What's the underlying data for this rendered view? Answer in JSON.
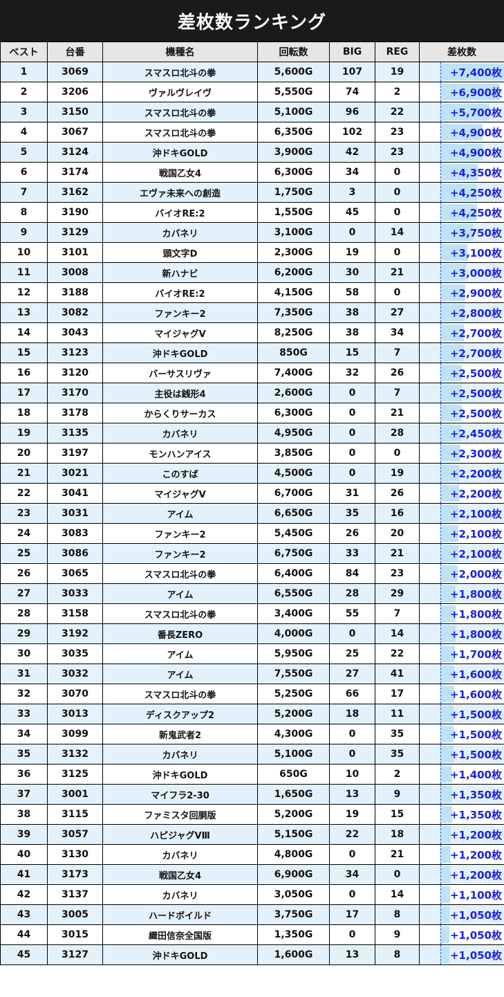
{
  "title": "差枚数ランキング",
  "colors": {
    "header_bg": "#1a1a1a",
    "row_alt": "#e3f1fc",
    "diff_text": "#1a22e0",
    "bar": "#bfe2f6"
  },
  "columns": [
    "ベスト",
    "台番",
    "機種名",
    "回転数",
    "BIG",
    "REG",
    "差枚数"
  ],
  "rows": [
    {
      "rank": "1",
      "machine": "3069",
      "model": "スマスロ北斗の拳",
      "spins": "5,600G",
      "big": "107",
      "reg": "19",
      "diff": "+7,400枚",
      "diff_value": 7400
    },
    {
      "rank": "2",
      "machine": "3206",
      "model": "ヴァルヴレイヴ",
      "spins": "5,550G",
      "big": "74",
      "reg": "2",
      "diff": "+6,900枚",
      "diff_value": 6900
    },
    {
      "rank": "3",
      "machine": "3150",
      "model": "スマスロ北斗の拳",
      "spins": "5,100G",
      "big": "96",
      "reg": "22",
      "diff": "+5,700枚",
      "diff_value": 5700
    },
    {
      "rank": "4",
      "machine": "3067",
      "model": "スマスロ北斗の拳",
      "spins": "6,350G",
      "big": "102",
      "reg": "23",
      "diff": "+4,900枚",
      "diff_value": 4900
    },
    {
      "rank": "5",
      "machine": "3124",
      "model": "沖ドキGOLD",
      "spins": "3,900G",
      "big": "42",
      "reg": "23",
      "diff": "+4,900枚",
      "diff_value": 4900
    },
    {
      "rank": "6",
      "machine": "3174",
      "model": "戦国乙女4",
      "spins": "6,300G",
      "big": "34",
      "reg": "0",
      "diff": "+4,350枚",
      "diff_value": 4350
    },
    {
      "rank": "7",
      "machine": "3162",
      "model": "エヴァ未来への創造",
      "spins": "1,750G",
      "big": "3",
      "reg": "0",
      "diff": "+4,250枚",
      "diff_value": 4250
    },
    {
      "rank": "8",
      "machine": "3190",
      "model": "バイオRE:2",
      "spins": "1,550G",
      "big": "45",
      "reg": "0",
      "diff": "+4,250枚",
      "diff_value": 4250
    },
    {
      "rank": "9",
      "machine": "3129",
      "model": "カバネリ",
      "spins": "3,100G",
      "big": "0",
      "reg": "14",
      "diff": "+3,750枚",
      "diff_value": 3750
    },
    {
      "rank": "10",
      "machine": "3101",
      "model": "頭文字D",
      "spins": "2,300G",
      "big": "19",
      "reg": "0",
      "diff": "+3,100枚",
      "diff_value": 3100
    },
    {
      "rank": "11",
      "machine": "3008",
      "model": "新ハナビ",
      "spins": "6,200G",
      "big": "30",
      "reg": "21",
      "diff": "+3,000枚",
      "diff_value": 3000
    },
    {
      "rank": "12",
      "machine": "3188",
      "model": "バイオRE:2",
      "spins": "4,150G",
      "big": "58",
      "reg": "0",
      "diff": "+2,900枚",
      "diff_value": 2900
    },
    {
      "rank": "13",
      "machine": "3082",
      "model": "ファンキー2",
      "spins": "7,350G",
      "big": "38",
      "reg": "27",
      "diff": "+2,800枚",
      "diff_value": 2800
    },
    {
      "rank": "14",
      "machine": "3043",
      "model": "マイジャグV",
      "spins": "8,250G",
      "big": "38",
      "reg": "34",
      "diff": "+2,700枚",
      "diff_value": 2700
    },
    {
      "rank": "15",
      "machine": "3123",
      "model": "沖ドキGOLD",
      "spins": "850G",
      "big": "15",
      "reg": "7",
      "diff": "+2,700枚",
      "diff_value": 2700
    },
    {
      "rank": "16",
      "machine": "3120",
      "model": "バーサスリヴァ",
      "spins": "7,400G",
      "big": "32",
      "reg": "26",
      "diff": "+2,500枚",
      "diff_value": 2500
    },
    {
      "rank": "17",
      "machine": "3170",
      "model": "主役は銭形4",
      "spins": "2,600G",
      "big": "0",
      "reg": "7",
      "diff": "+2,500枚",
      "diff_value": 2500
    },
    {
      "rank": "18",
      "machine": "3178",
      "model": "からくりサーカス",
      "spins": "6,300G",
      "big": "0",
      "reg": "21",
      "diff": "+2,500枚",
      "diff_value": 2500
    },
    {
      "rank": "19",
      "machine": "3135",
      "model": "カバネリ",
      "spins": "4,950G",
      "big": "0",
      "reg": "28",
      "diff": "+2,450枚",
      "diff_value": 2450
    },
    {
      "rank": "20",
      "machine": "3197",
      "model": "モンハンアイス",
      "spins": "3,850G",
      "big": "0",
      "reg": "0",
      "diff": "+2,300枚",
      "diff_value": 2300
    },
    {
      "rank": "21",
      "machine": "3021",
      "model": "このすば",
      "spins": "4,500G",
      "big": "0",
      "reg": "19",
      "diff": "+2,200枚",
      "diff_value": 2200
    },
    {
      "rank": "22",
      "machine": "3041",
      "model": "マイジャグV",
      "spins": "6,700G",
      "big": "31",
      "reg": "26",
      "diff": "+2,200枚",
      "diff_value": 2200
    },
    {
      "rank": "23",
      "machine": "3031",
      "model": "アイム",
      "spins": "6,650G",
      "big": "35",
      "reg": "16",
      "diff": "+2,100枚",
      "diff_value": 2100
    },
    {
      "rank": "24",
      "machine": "3083",
      "model": "ファンキー2",
      "spins": "5,450G",
      "big": "26",
      "reg": "20",
      "diff": "+2,100枚",
      "diff_value": 2100
    },
    {
      "rank": "25",
      "machine": "3086",
      "model": "ファンキー2",
      "spins": "6,750G",
      "big": "33",
      "reg": "21",
      "diff": "+2,100枚",
      "diff_value": 2100
    },
    {
      "rank": "26",
      "machine": "3065",
      "model": "スマスロ北斗の拳",
      "spins": "6,400G",
      "big": "84",
      "reg": "23",
      "diff": "+2,000枚",
      "diff_value": 2000
    },
    {
      "rank": "27",
      "machine": "3033",
      "model": "アイム",
      "spins": "6,550G",
      "big": "28",
      "reg": "29",
      "diff": "+1,800枚",
      "diff_value": 1800
    },
    {
      "rank": "28",
      "machine": "3158",
      "model": "スマスロ北斗の拳",
      "spins": "3,400G",
      "big": "55",
      "reg": "7",
      "diff": "+1,800枚",
      "diff_value": 1800
    },
    {
      "rank": "29",
      "machine": "3192",
      "model": "番長ZERO",
      "spins": "4,000G",
      "big": "0",
      "reg": "14",
      "diff": "+1,800枚",
      "diff_value": 1800
    },
    {
      "rank": "30",
      "machine": "3035",
      "model": "アイム",
      "spins": "5,950G",
      "big": "25",
      "reg": "22",
      "diff": "+1,700枚",
      "diff_value": 1700
    },
    {
      "rank": "31",
      "machine": "3032",
      "model": "アイム",
      "spins": "7,550G",
      "big": "27",
      "reg": "41",
      "diff": "+1,600枚",
      "diff_value": 1600
    },
    {
      "rank": "32",
      "machine": "3070",
      "model": "スマスロ北斗の拳",
      "spins": "5,250G",
      "big": "66",
      "reg": "17",
      "diff": "+1,600枚",
      "diff_value": 1600
    },
    {
      "rank": "33",
      "machine": "3013",
      "model": "ディスクアップ2",
      "spins": "5,200G",
      "big": "18",
      "reg": "11",
      "diff": "+1,500枚",
      "diff_value": 1500
    },
    {
      "rank": "34",
      "machine": "3099",
      "model": "新鬼武者2",
      "spins": "4,300G",
      "big": "0",
      "reg": "35",
      "diff": "+1,500枚",
      "diff_value": 1500
    },
    {
      "rank": "35",
      "machine": "3132",
      "model": "カバネリ",
      "spins": "5,100G",
      "big": "0",
      "reg": "35",
      "diff": "+1,500枚",
      "diff_value": 1500
    },
    {
      "rank": "36",
      "machine": "3125",
      "model": "沖ドキGOLD",
      "spins": "650G",
      "big": "10",
      "reg": "2",
      "diff": "+1,400枚",
      "diff_value": 1400
    },
    {
      "rank": "37",
      "machine": "3001",
      "model": "マイフラ2-30",
      "spins": "1,650G",
      "big": "13",
      "reg": "9",
      "diff": "+1,350枚",
      "diff_value": 1350
    },
    {
      "rank": "38",
      "machine": "3115",
      "model": "ファミスタ回胴版",
      "spins": "5,200G",
      "big": "19",
      "reg": "15",
      "diff": "+1,350枚",
      "diff_value": 1350
    },
    {
      "rank": "39",
      "machine": "3057",
      "model": "ハピジャグVⅢ",
      "spins": "5,150G",
      "big": "22",
      "reg": "18",
      "diff": "+1,200枚",
      "diff_value": 1200
    },
    {
      "rank": "40",
      "machine": "3130",
      "model": "カバネリ",
      "spins": "4,800G",
      "big": "0",
      "reg": "21",
      "diff": "+1,200枚",
      "diff_value": 1200
    },
    {
      "rank": "41",
      "machine": "3173",
      "model": "戦国乙女4",
      "spins": "6,900G",
      "big": "34",
      "reg": "0",
      "diff": "+1,200枚",
      "diff_value": 1200
    },
    {
      "rank": "42",
      "machine": "3137",
      "model": "カバネリ",
      "spins": "3,050G",
      "big": "0",
      "reg": "14",
      "diff": "+1,100枚",
      "diff_value": 1100
    },
    {
      "rank": "43",
      "machine": "3005",
      "model": "ハードボイルド",
      "spins": "3,750G",
      "big": "17",
      "reg": "8",
      "diff": "+1,050枚",
      "diff_value": 1050
    },
    {
      "rank": "44",
      "machine": "3015",
      "model": "織田信奈全国版",
      "spins": "1,350G",
      "big": "0",
      "reg": "9",
      "diff": "+1,050枚",
      "diff_value": 1050
    },
    {
      "rank": "45",
      "machine": "3127",
      "model": "沖ドキGOLD",
      "spins": "1,600G",
      "big": "13",
      "reg": "8",
      "diff": "+1,050枚",
      "diff_value": 1050
    }
  ]
}
